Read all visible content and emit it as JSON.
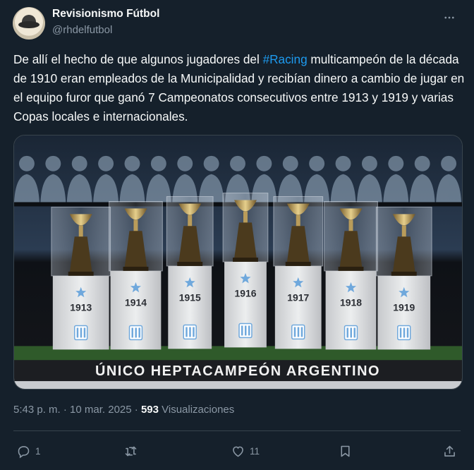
{
  "author": {
    "name": "Revisionismo Fútbol",
    "handle": "@rhdelfutbol"
  },
  "tweet": {
    "text_before": "De allí el hecho de que algunos jugadores del ",
    "hashtag": "#Racing",
    "text_after": " multicampeón de la década de 1910 eran empleados de la Municipalidad y recibían dinero a cambio de jugar en el equipo furor que ganó 7 Campeonatos consecutivos entre 1913 y 1919 y varias Copas locales e internacionales."
  },
  "media": {
    "years": [
      "1913",
      "1914",
      "1915",
      "1916",
      "1917",
      "1918",
      "1919"
    ],
    "banner": "ÚNICO HEPTACAMPEÓN ARGENTINO"
  },
  "meta": {
    "timestamp": "5:43 p. m. · 10 mar. 2025 · ",
    "views_count": "593",
    "views_label": " Visualizaciones"
  },
  "actions": {
    "replies": "1",
    "retweets": "",
    "likes": "11"
  },
  "colors": {
    "background": "#15202b",
    "text": "#f7f9f9",
    "secondary": "#8b98a5",
    "link": "#1d9bf0",
    "divider": "#38444d"
  }
}
